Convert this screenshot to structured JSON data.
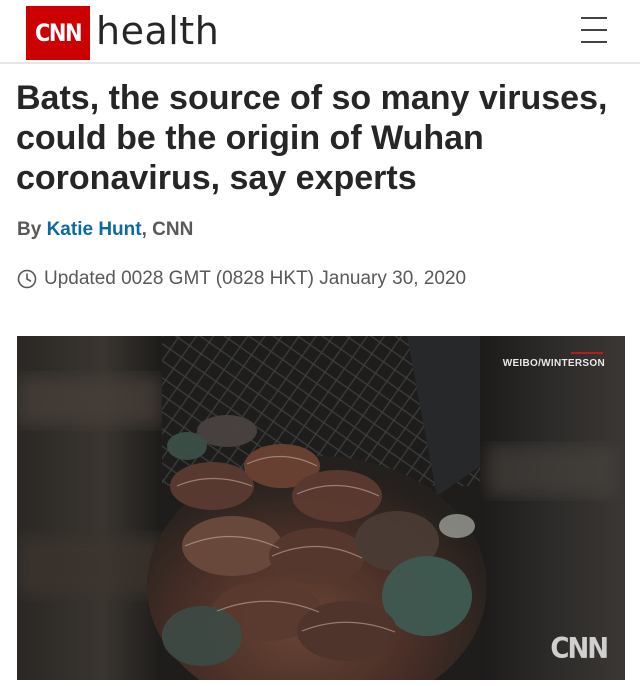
{
  "header": {
    "logo_text": "CNN",
    "section": "health",
    "menu_icon": "hamburger-menu-icon",
    "brand_color": "#cc0000"
  },
  "article": {
    "headline": "Bats, the source of so many viruses, could be the origin of Wuhan coronavirus, say experts",
    "byline_prefix": "By ",
    "author": "Katie Hunt",
    "byline_suffix": ", CNN",
    "updated": "Updated 0028 GMT (0828 HKT) January 30, 2020",
    "clock_icon": "clock-icon"
  },
  "video": {
    "credit": "WEIBO/WINTERSON",
    "watermark": "CNN"
  }
}
